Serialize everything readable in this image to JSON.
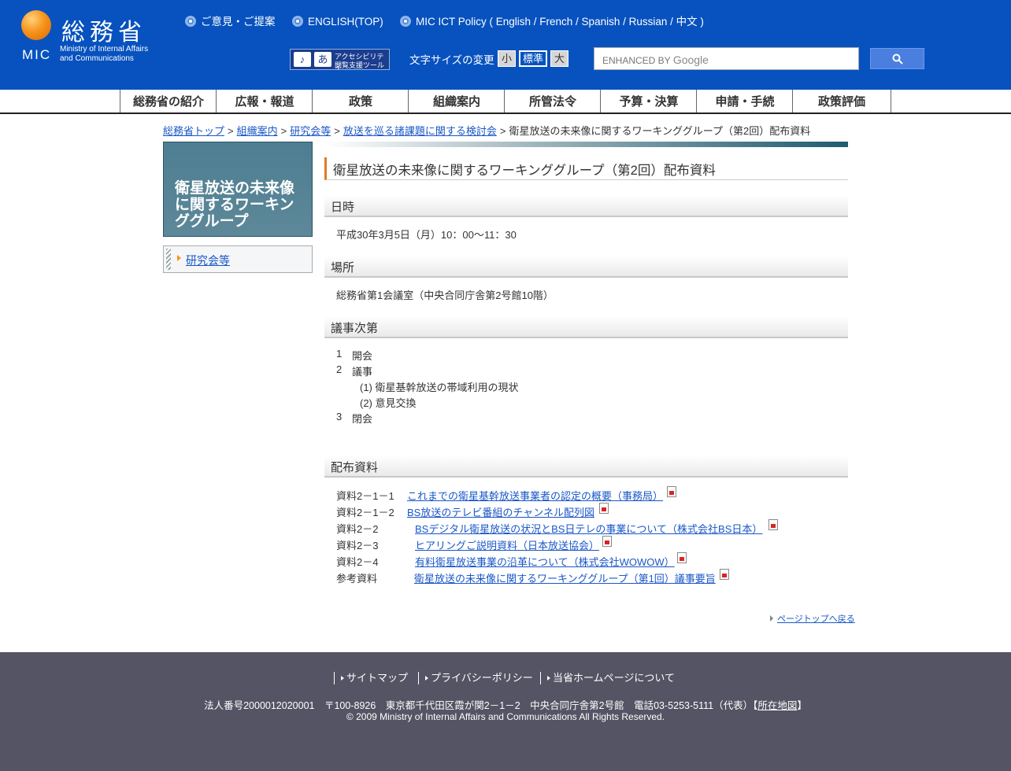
{
  "header": {
    "logo": {
      "kanji": "総務省",
      "abbr": "MIC",
      "eng_line1": "Ministry of Internal Affairs",
      "eng_line2": "and Communications"
    },
    "top_links": [
      "ご意見・ご提案",
      "ENGLISH(TOP)",
      "MIC ICT Policy ( English / French / Spanish / Russian / 中文 )"
    ],
    "accessibility": {
      "line1": "アクセシビリティ",
      "line2": "閲覧支援ツール"
    },
    "font_size_label": "文字サイズの変更",
    "font_sizes": [
      "小",
      "標準",
      "大"
    ],
    "search": {
      "prefix": "ENHANCED BY",
      "brand": "Google"
    }
  },
  "gnav": [
    "総務省の紹介",
    "広報・報道",
    "政策",
    "組織案内",
    "所管法令",
    "予算・決算",
    "申請・手続",
    "政策評価"
  ],
  "breadcrumb": {
    "links": [
      "総務省トップ",
      "組織案内",
      "研究会等",
      "放送を巡る諸課題に関する検討会"
    ],
    "current": "衛星放送の未来像に関するワーキンググループ（第2回）配布資料",
    "separator": ">"
  },
  "sidebar": {
    "title": "衛星放送の未来像に関するワーキンググループ",
    "menu_item": "研究会等"
  },
  "main": {
    "title": "衛星放送の未来像に関するワーキンググループ（第2回）配布資料",
    "datetime": {
      "heading": "日時",
      "text": "平成30年3月5日（月）10：00～11：30"
    },
    "place": {
      "heading": "場所",
      "text": "総務省第1会議室（中央合同庁舎第2号館10階）"
    },
    "agenda": {
      "heading": "議事次第",
      "items": [
        {
          "num": "1",
          "text": "開会"
        },
        {
          "num": "2",
          "text": "議事"
        },
        {
          "num": "",
          "text": "(1) 衛星基幹放送の帯域利用の現状"
        },
        {
          "num": "",
          "text": "(2) 意見交換"
        },
        {
          "num": "3",
          "text": "閉会"
        }
      ]
    },
    "documents": {
      "heading": "配布資料",
      "rows": [
        {
          "label": "資料2－1－1",
          "title": "これまでの衛星基幹放送事業者の認定の概要（事務局）"
        },
        {
          "label": "資料2－1－2",
          "title": "BS放送のテレビ番組のチャンネル配列図"
        },
        {
          "label": "資料2－2",
          "title": "BSデジタル衛星放送の状況とBS日テレの事業について（株式会社BS日本）"
        },
        {
          "label": "資料2－3",
          "title": "ヒアリングご説明資料（日本放送協会）"
        },
        {
          "label": "資料2－4",
          "title": "有料衛星放送事業の沿革について（株式会社WOWOW）"
        },
        {
          "label": "参考資料",
          "title": "衛星放送の未来像に関するワーキンググループ（第1回）議事要旨"
        }
      ]
    },
    "page_top": "ページトップへ戻る"
  },
  "footer": {
    "links": [
      "サイトマップ",
      "プライバシーポリシー",
      "当省ホームページについて"
    ],
    "address": "法人番号2000012020001　〒100-8926　東京都千代田区霞が関2－1－2　中央合同庁舎第2号館　電話03-5253-5111（代表）",
    "map_open": "【",
    "map_link": "所在地図",
    "map_close": "】",
    "copyright": "© 2009 Ministry of Internal Affairs and Communications All Rights Reserved."
  }
}
